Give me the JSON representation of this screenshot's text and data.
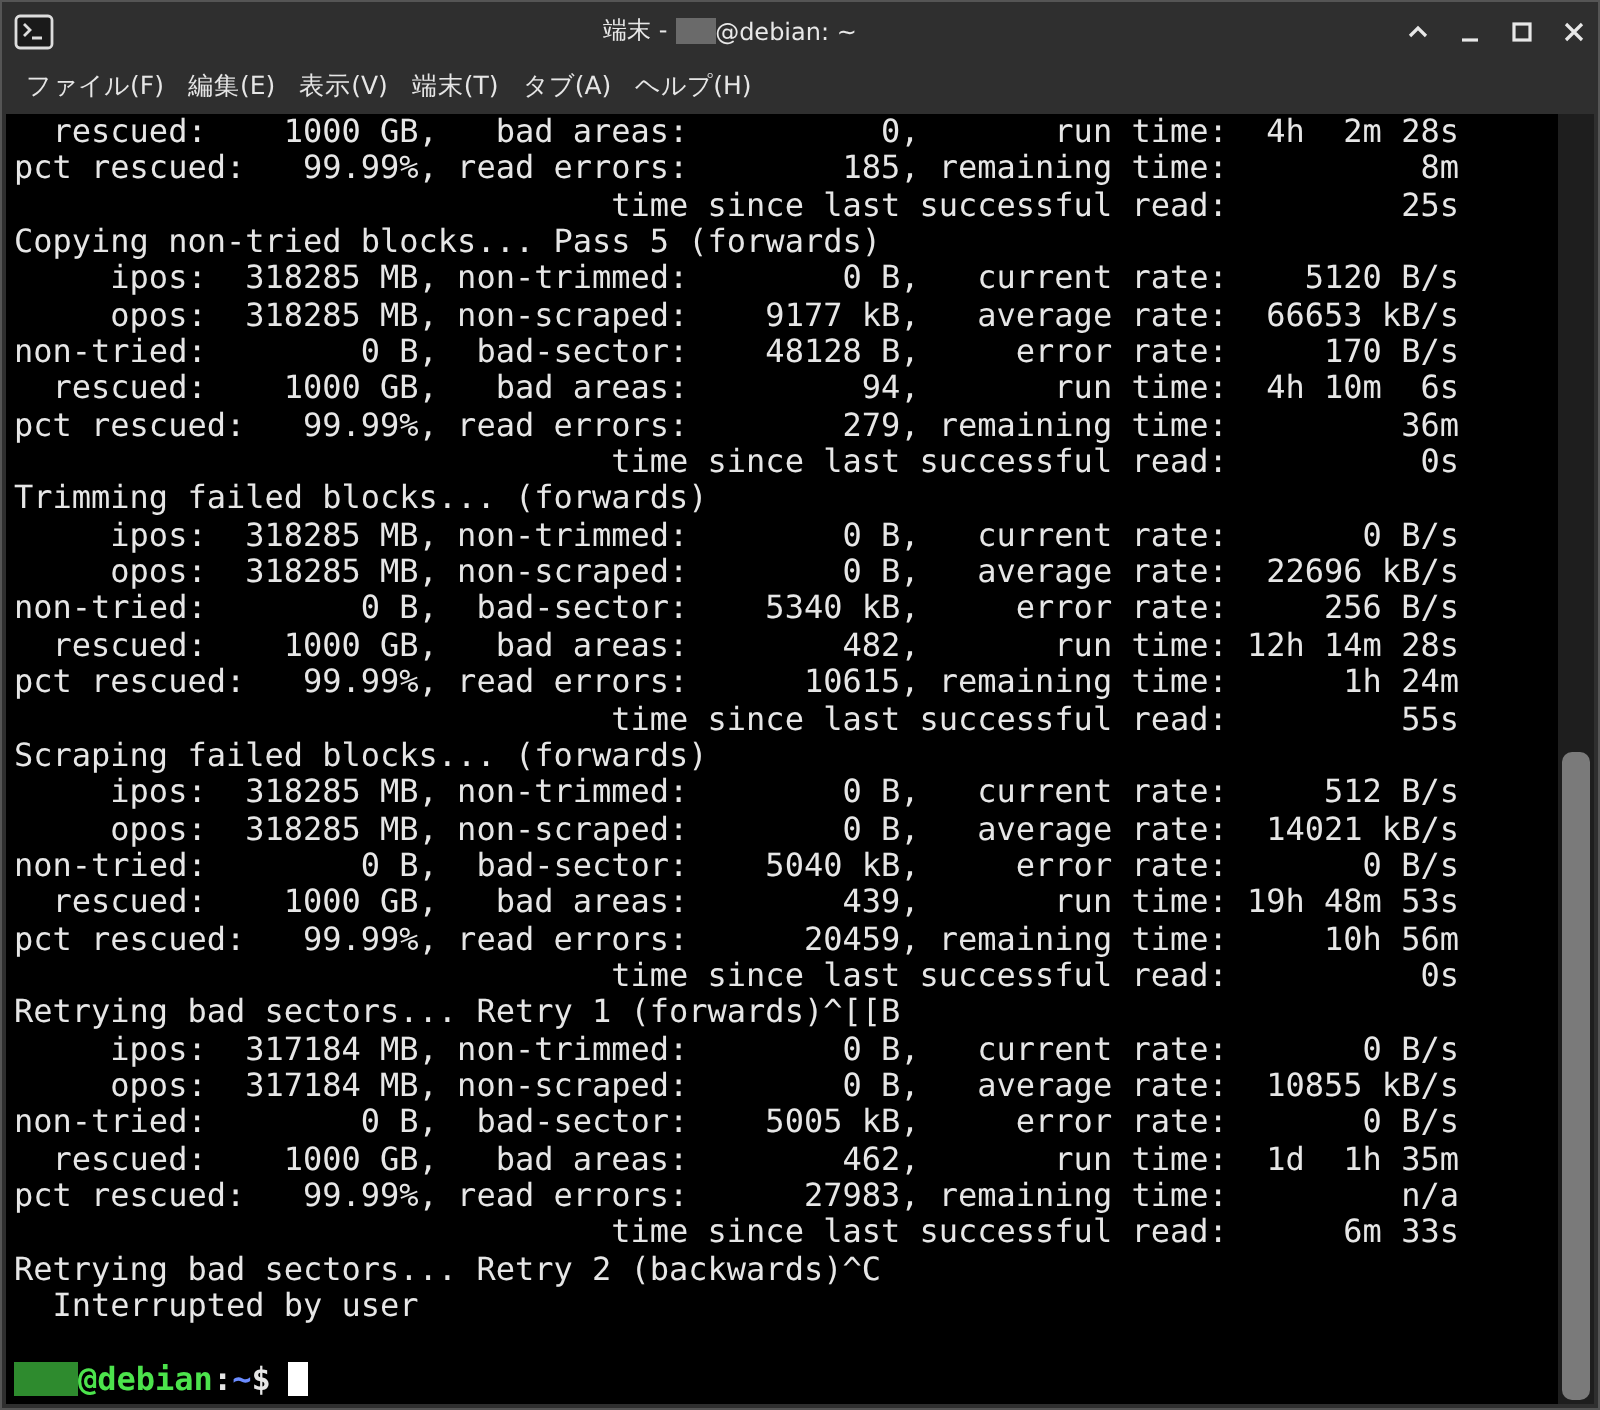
{
  "window": {
    "title_prefix": "端末 - ",
    "title_suffix": "@debian: ~"
  },
  "menu": [
    "ファイル(F)",
    "編集(E)",
    "表示(V)",
    "端末(T)",
    "タブ(A)",
    "ヘルプ(H)"
  ],
  "terminal": {
    "lines": [
      "  rescued:    1000 GB,   bad areas:          0,       run time:  4h  2m 28s",
      "pct rescued:   99.99%, read errors:        185, remaining time:          8m",
      "                               time since last successful read:         25s",
      "Copying non-tried blocks... Pass 5 (forwards)",
      "     ipos:  318285 MB, non-trimmed:        0 B,   current rate:    5120 B/s",
      "     opos:  318285 MB, non-scraped:    9177 kB,   average rate:  66653 kB/s",
      "non-tried:        0 B,  bad-sector:    48128 B,     error rate:     170 B/s",
      "  rescued:    1000 GB,   bad areas:         94,       run time:  4h 10m  6s",
      "pct rescued:   99.99%, read errors:        279, remaining time:         36m",
      "                               time since last successful read:          0s",
      "Trimming failed blocks... (forwards)",
      "     ipos:  318285 MB, non-trimmed:        0 B,   current rate:       0 B/s",
      "     opos:  318285 MB, non-scraped:        0 B,   average rate:  22696 kB/s",
      "non-tried:        0 B,  bad-sector:    5340 kB,     error rate:     256 B/s",
      "  rescued:    1000 GB,   bad areas:        482,       run time: 12h 14m 28s",
      "pct rescued:   99.99%, read errors:      10615, remaining time:      1h 24m",
      "                               time since last successful read:         55s",
      "Scraping failed blocks... (forwards)",
      "     ipos:  318285 MB, non-trimmed:        0 B,   current rate:     512 B/s",
      "     opos:  318285 MB, non-scraped:        0 B,   average rate:  14021 kB/s",
      "non-tried:        0 B,  bad-sector:    5040 kB,     error rate:       0 B/s",
      "  rescued:    1000 GB,   bad areas:        439,       run time: 19h 48m 53s",
      "pct rescued:   99.99%, read errors:      20459, remaining time:     10h 56m",
      "                               time since last successful read:          0s",
      "Retrying bad sectors... Retry 1 (forwards)^[[B",
      "     ipos:  317184 MB, non-trimmed:        0 B,   current rate:       0 B/s",
      "     opos:  317184 MB, non-scraped:        0 B,   average rate:  10855 kB/s",
      "non-tried:        0 B,  bad-sector:    5005 kB,     error rate:       0 B/s",
      "  rescued:    1000 GB,   bad areas:        462,       run time:  1d  1h 35m",
      "pct rescued:   99.99%, read errors:      27983, remaining time:         n/a",
      "                               time since last successful read:      6m 33s",
      "Retrying bad sectors... Retry 2 (backwards)^C",
      "  Interrupted by user"
    ],
    "prompt": {
      "host": "@debian",
      "separator": ":",
      "path": "~",
      "symbol": "$"
    }
  }
}
